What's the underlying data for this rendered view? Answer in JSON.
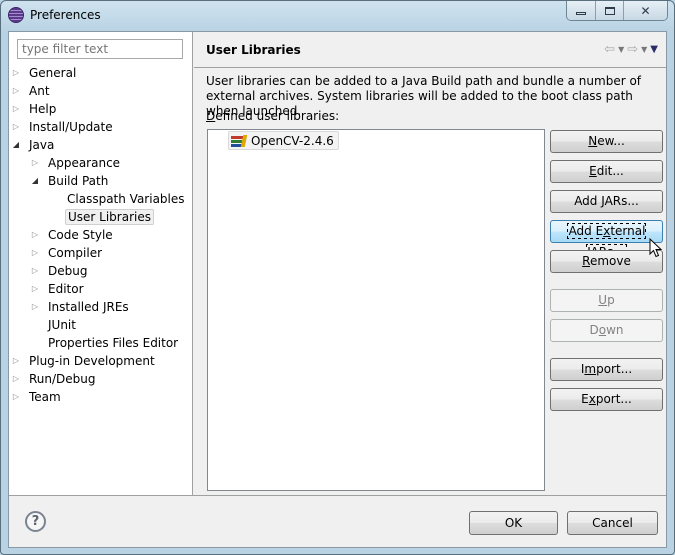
{
  "window": {
    "title": "Preferences",
    "caption_buttons": {
      "minimize": "minimize",
      "maximize": "maximize",
      "close": "close"
    }
  },
  "sidebar": {
    "filter_placeholder": "type filter text",
    "tree": [
      {
        "label": "General",
        "level": 0,
        "state": "collapsed"
      },
      {
        "label": "Ant",
        "level": 0,
        "state": "collapsed"
      },
      {
        "label": "Help",
        "level": 0,
        "state": "collapsed"
      },
      {
        "label": "Install/Update",
        "level": 0,
        "state": "collapsed"
      },
      {
        "label": "Java",
        "level": 0,
        "state": "expanded"
      },
      {
        "label": "Appearance",
        "level": 1,
        "state": "collapsed"
      },
      {
        "label": "Build Path",
        "level": 1,
        "state": "expanded"
      },
      {
        "label": "Classpath Variables",
        "level": 2,
        "state": "leaf"
      },
      {
        "label": "User Libraries",
        "level": 2,
        "state": "leaf",
        "selected": true
      },
      {
        "label": "Code Style",
        "level": 1,
        "state": "collapsed"
      },
      {
        "label": "Compiler",
        "level": 1,
        "state": "collapsed"
      },
      {
        "label": "Debug",
        "level": 1,
        "state": "collapsed"
      },
      {
        "label": "Editor",
        "level": 1,
        "state": "collapsed"
      },
      {
        "label": "Installed JREs",
        "level": 1,
        "state": "collapsed"
      },
      {
        "label": "JUnit",
        "level": 1,
        "state": "leaf"
      },
      {
        "label": "Properties Files Editor",
        "level": 1,
        "state": "leaf"
      },
      {
        "label": "Plug-in Development",
        "level": 0,
        "state": "collapsed"
      },
      {
        "label": "Run/Debug",
        "level": 0,
        "state": "collapsed"
      },
      {
        "label": "Team",
        "level": 0,
        "state": "collapsed"
      }
    ]
  },
  "page": {
    "title": "User Libraries",
    "description": "User libraries can be added to a Java Build path and bundle a number of external archives. System libraries will be added to the boot class path when launched.",
    "defined_label": "Defined user libraries:",
    "libraries": [
      {
        "name": "OpenCV-2.4.6",
        "icon": "library-icon"
      }
    ],
    "buttons": [
      {
        "id": "new",
        "label": "New...",
        "mnemonic": "N",
        "enabled": true
      },
      {
        "id": "edit",
        "label": "Edit...",
        "mnemonic": "E",
        "enabled": true
      },
      {
        "id": "add-jars",
        "label": "Add JARs...",
        "mnemonic": "J",
        "enabled": true
      },
      {
        "id": "add-external-jars",
        "label": "Add External JARs...",
        "mnemonic": "x",
        "enabled": true,
        "focused": true
      },
      {
        "id": "remove",
        "label": "Remove",
        "mnemonic": "R",
        "enabled": true
      },
      {
        "id": "up",
        "label": "Up",
        "mnemonic": "U",
        "enabled": false
      },
      {
        "id": "down",
        "label": "Down",
        "mnemonic": "o",
        "enabled": false
      },
      {
        "id": "import",
        "label": "Import...",
        "mnemonic": "m",
        "enabled": true
      },
      {
        "id": "export",
        "label": "Export...",
        "mnemonic": "x",
        "enabled": true
      }
    ]
  },
  "footer": {
    "help_glyph": "?",
    "ok_label": "OK",
    "cancel_label": "Cancel"
  }
}
